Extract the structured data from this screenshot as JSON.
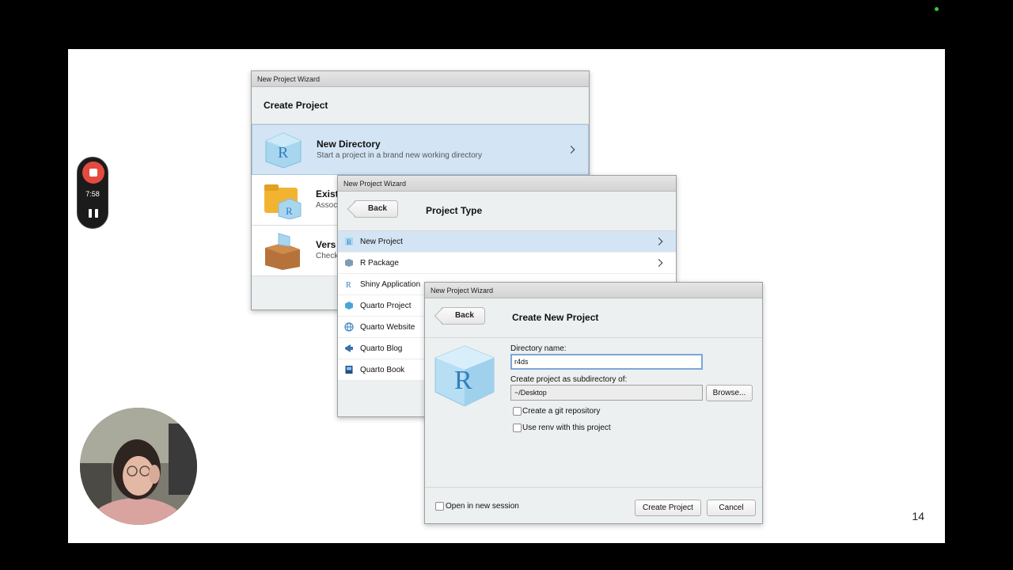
{
  "recorder": {
    "time": "7:58"
  },
  "slide": {
    "number": "14"
  },
  "dialog1": {
    "window_title": "New Project Wizard",
    "header": "Create Project",
    "options": [
      {
        "title": "New Directory",
        "subtitle": "Start a project in a brand new working directory"
      },
      {
        "title": "Exist",
        "subtitle": "Assoc"
      },
      {
        "title": "Vers",
        "subtitle": "Check"
      }
    ]
  },
  "dialog2": {
    "window_title": "New Project Wizard",
    "back_label": "Back",
    "header": "Project Type",
    "types": [
      {
        "label": "New Project"
      },
      {
        "label": "R Package"
      },
      {
        "label": "Shiny Application"
      },
      {
        "label": "Quarto Project"
      },
      {
        "label": "Quarto Website"
      },
      {
        "label": "Quarto Blog"
      },
      {
        "label": "Quarto Book"
      }
    ]
  },
  "dialog3": {
    "window_title": "New Project Wizard",
    "back_label": "Back",
    "header": "Create New Project",
    "directory_name_label": "Directory name:",
    "directory_name_value": "r4ds",
    "subdir_label": "Create project as subdirectory of:",
    "subdir_value": "~/Desktop",
    "browse_label": "Browse...",
    "git_label": "Create a git repository",
    "renv_label": "Use renv with this project",
    "new_session_label": "Open in new session",
    "create_label": "Create Project",
    "cancel_label": "Cancel"
  },
  "colors": {
    "selection": "#d3e5f4",
    "record": "#e34b3f",
    "r_blue": "#2f7fc1"
  }
}
